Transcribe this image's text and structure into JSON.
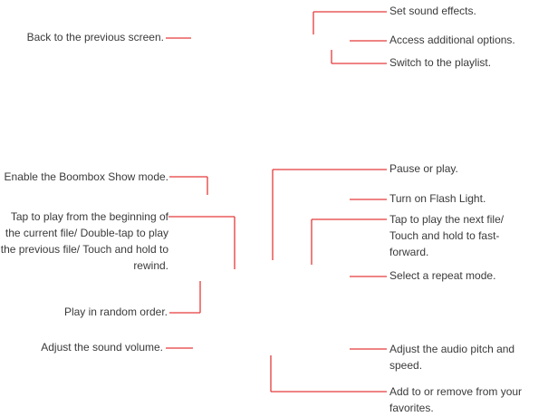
{
  "callouts": {
    "back": "Back to the previous screen.",
    "sound_effects": "Set sound effects.",
    "additional_options": "Access additional options.",
    "playlist": "Switch to the playlist.",
    "boombox": "Enable the Boombox Show mode.",
    "pause_play": "Pause or play.",
    "flash_light": "Turn on Flash Light.",
    "play_previous": "Tap to play from the beginning of the current file/ Double-tap to play the previous file/ Touch and hold to rewind.",
    "play_next": "Tap to play the next file/ Touch and hold to fast-forward.",
    "repeat": "Select a repeat mode.",
    "random": "Play in random order.",
    "volume": "Adjust the sound volume.",
    "pitch_speed": "Adjust the audio pitch and speed.",
    "favorites": "Add to or remove from your favorites."
  },
  "colors": {
    "leader_line": "#e53a3a",
    "text": "#3a3a3a",
    "background": "#ffffff"
  }
}
